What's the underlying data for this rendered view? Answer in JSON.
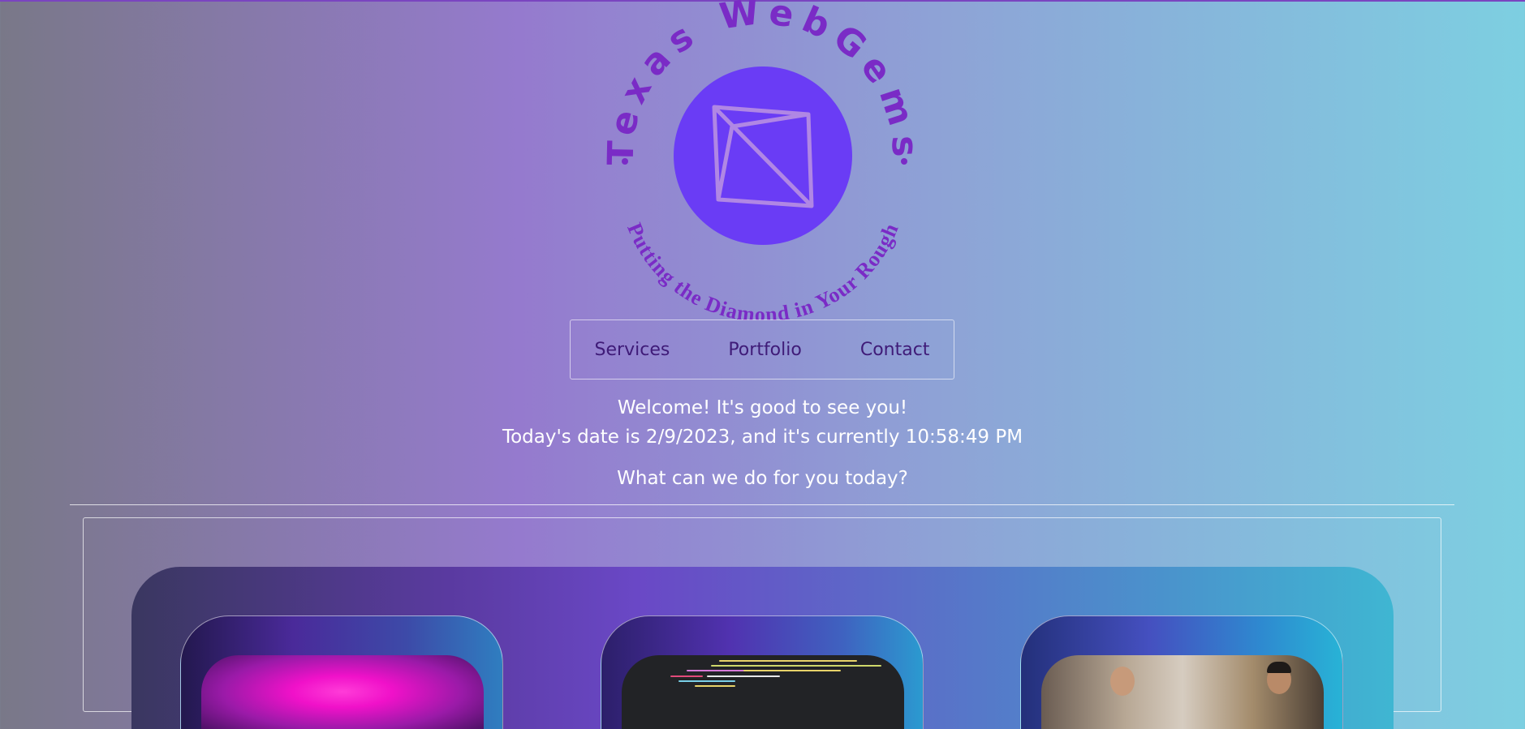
{
  "brand": {
    "name": "Texas WebGems",
    "tagline": "Putting the Diamond in Your Rough",
    "colors": {
      "circle": "#6a3cf5",
      "text": "#7a2bc6",
      "gem_lines": "#b087e4"
    }
  },
  "nav": {
    "items": [
      {
        "label": "Services"
      },
      {
        "label": "Portfolio"
      },
      {
        "label": "Contact"
      }
    ]
  },
  "welcome": {
    "greeting": "Welcome! It's good to see you!",
    "datetime": "Today's date is 2/9/2023, and it's currently 10:58:49 PM",
    "question": "What can we do for you today?"
  },
  "colors": {
    "nav_text": "#3f1b78",
    "body_text": "#ffffff"
  }
}
